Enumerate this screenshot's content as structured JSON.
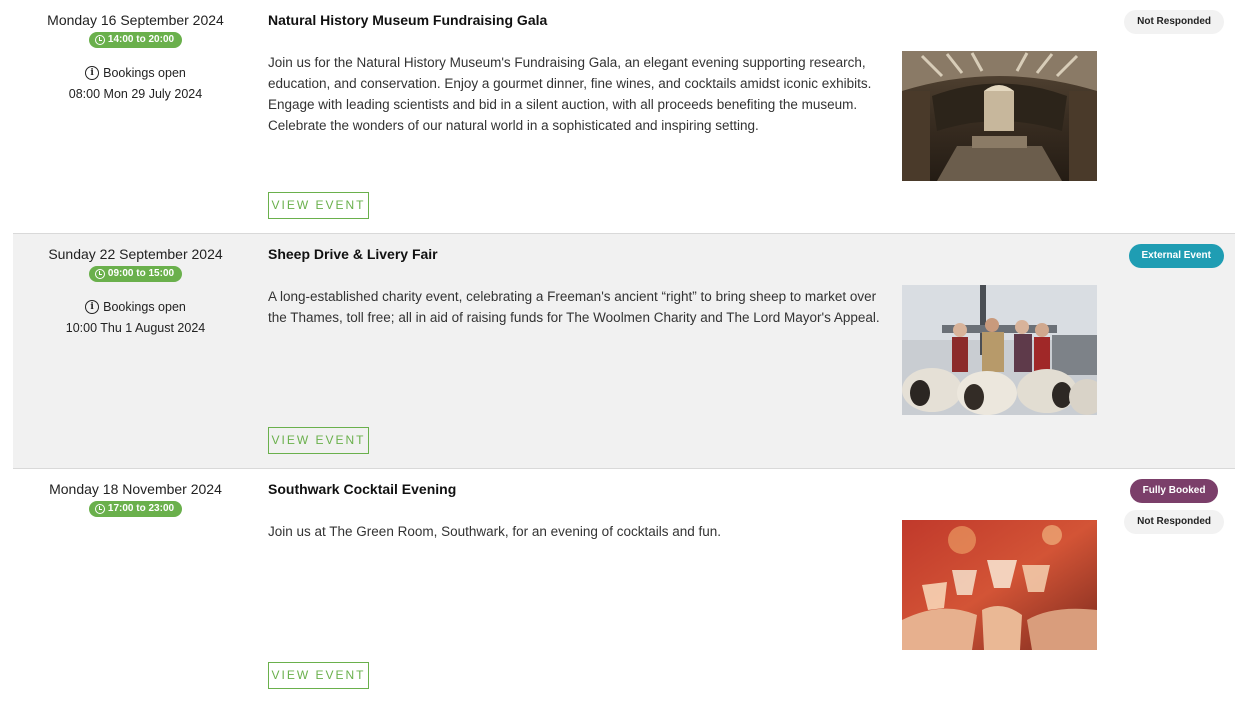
{
  "events": [
    {
      "date": "Monday 16 September 2024",
      "time": "14:00 to 20:00",
      "bookings_label": "Bookings open",
      "bookings_date": "08:00 Mon 29 July 2024",
      "title": "Natural History Museum Fundraising Gala",
      "description": "Join us for the Natural History Museum's Fundraising Gala, an elegant evening supporting research, education, and conservation. Enjoy a gourmet dinner, fine wines, and cocktails amidst iconic exhibits. Engage with leading scientists and bid in a silent auction, with all proceeds benefiting the museum. Celebrate the wonders of our natural world in a sophisticated and inspiring setting.",
      "button_label": "VIEW EVENT",
      "image": "museum-hall-photo",
      "statuses": [
        "Not Responded"
      ]
    },
    {
      "date": "Sunday 22 September 2024",
      "time": "09:00 to 15:00",
      "bookings_label": "Bookings open",
      "bookings_date": "10:00 Thu 1 August 2024",
      "title": "Sheep Drive & Livery Fair",
      "description": "A long-established charity event, celebrating a Freeman's ancient “right” to bring sheep to market over the Thames, toll free; all in aid of raising funds for The Woolmen Charity and The Lord Mayor's Appeal.",
      "button_label": "VIEW EVENT",
      "image": "sheep-on-bridge-photo",
      "statuses": [
        "External Event"
      ]
    },
    {
      "date": "Monday 18 November 2024",
      "time": "17:00 to 23:00",
      "title": "Southwark Cocktail Evening",
      "description": "Join us at The Green Room, Southwark, for an evening of cocktails and fun.",
      "button_label": "VIEW EVENT",
      "image": "cocktail-toast-photo",
      "statuses": [
        "Fully Booked",
        "Not Responded"
      ]
    }
  ],
  "colors": {
    "accent_green": "#6ab04c",
    "external_teal": "#1f9db3",
    "booked_purple": "#7b3f6a",
    "row_shade": "#f1f1f1"
  }
}
